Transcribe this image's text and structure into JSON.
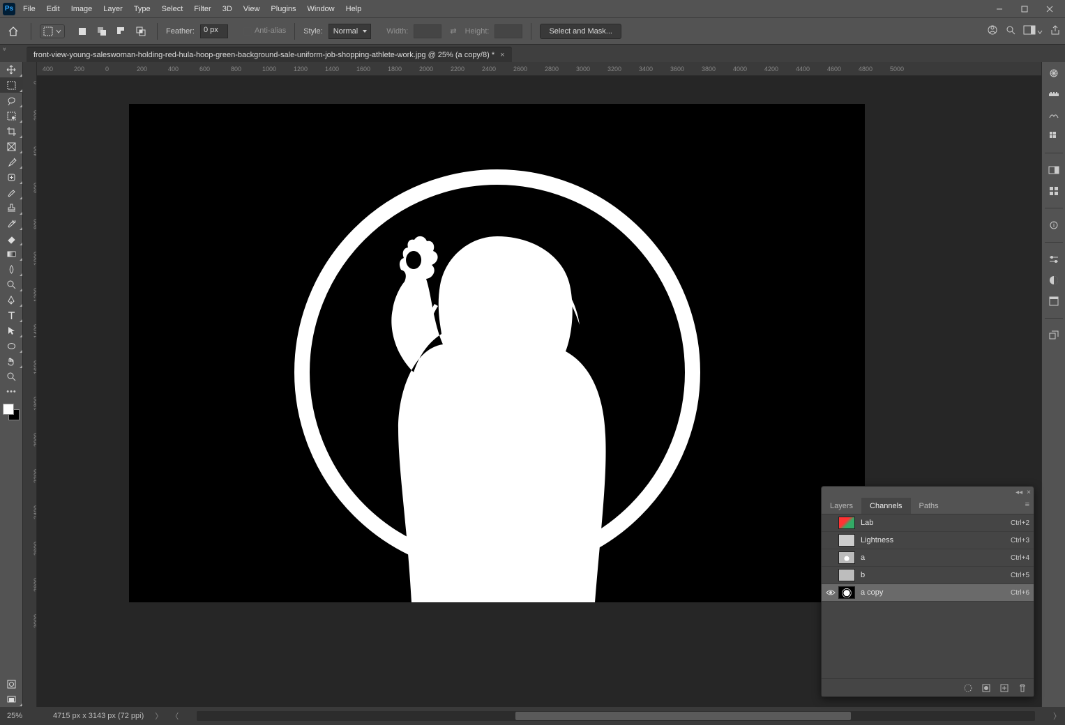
{
  "menu": {
    "file": "File",
    "edit": "Edit",
    "image": "Image",
    "layer": "Layer",
    "type": "Type",
    "select": "Select",
    "filter": "Filter",
    "threeD": "3D",
    "view": "View",
    "plugins": "Plugins",
    "window": "Window",
    "help": "Help"
  },
  "app_icon_text": "Ps",
  "options": {
    "feather_label": "Feather:",
    "feather_value": "0 px",
    "antialias_label": "Anti-alias",
    "style_label": "Style:",
    "style_value": "Normal",
    "width_label": "Width:",
    "height_label": "Height:",
    "select_mask": "Select and Mask..."
  },
  "document": {
    "tab_title": "front-view-young-saleswoman-holding-red-hula-hoop-green-background-sale-uniform-job-shopping-athlete-work.jpg @ 25% (a copy/8) *"
  },
  "hruler_ticks": [
    "400",
    "200",
    "0",
    "200",
    "400",
    "600",
    "800",
    "1000",
    "1200",
    "1400",
    "1600",
    "1800",
    "2000",
    "2200",
    "2400",
    "2600",
    "2800",
    "3000",
    "3200",
    "3400",
    "3600",
    "3800",
    "4000",
    "4200",
    "4400",
    "4600",
    "4800",
    "5000"
  ],
  "vruler_ticks": [
    "0",
    "200",
    "400",
    "600",
    "800",
    "1000",
    "1200",
    "1400",
    "1600",
    "1800",
    "2000",
    "2200",
    "2400",
    "2600",
    "2800",
    "3000"
  ],
  "panel": {
    "tabs": {
      "layers": "Layers",
      "channels": "Channels",
      "paths": "Paths"
    },
    "channels": [
      {
        "name": "Lab",
        "shortcut": "Ctrl+2",
        "visible": false,
        "selected": false,
        "thumb": "lab"
      },
      {
        "name": "Lightness",
        "shortcut": "Ctrl+3",
        "visible": false,
        "selected": false,
        "thumb": "light"
      },
      {
        "name": "a",
        "shortcut": "Ctrl+4",
        "visible": false,
        "selected": false,
        "thumb": "a"
      },
      {
        "name": "b",
        "shortcut": "Ctrl+5",
        "visible": false,
        "selected": false,
        "thumb": "b"
      },
      {
        "name": "a copy",
        "shortcut": "Ctrl+6",
        "visible": true,
        "selected": true,
        "thumb": "acopy"
      }
    ]
  },
  "status": {
    "zoom": "25%",
    "dimensions": "4715 px x 3143 px (72 ppi)"
  }
}
